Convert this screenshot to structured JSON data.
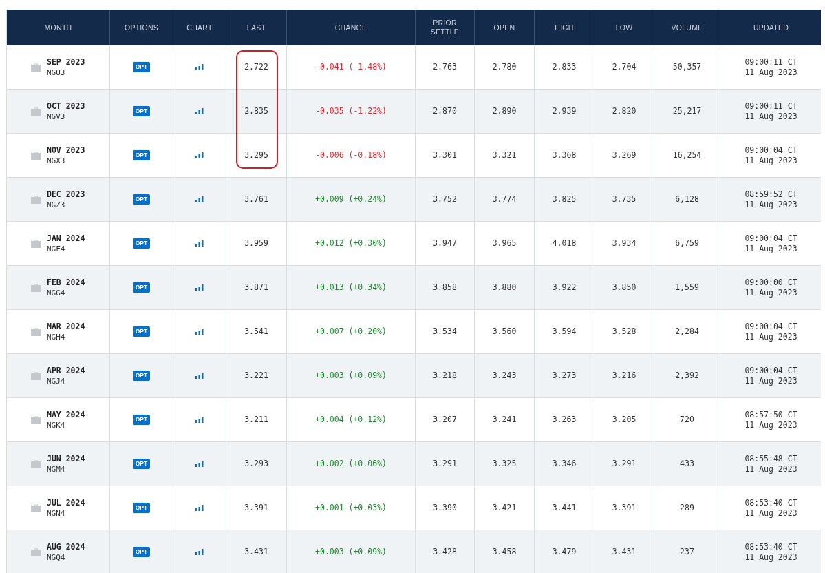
{
  "table": {
    "columns": [
      "MONTH",
      "OPTIONS",
      "CHART",
      "LAST",
      "CHANGE",
      "PRIOR SETTLE",
      "OPEN",
      "HIGH",
      "LOW",
      "VOLUME",
      "UPDATED"
    ],
    "rows": [
      {
        "month": "SEP 2023",
        "code": "NGU3",
        "options": "OPT",
        "last": "2.722",
        "change": "-0.041 (-1.48%)",
        "color": "#e8262b",
        "prior_settle": "2.763",
        "open": "2.780",
        "high": "2.833",
        "low": "2.704",
        "volume": "50,357",
        "updated_time": "09:00:11 CT",
        "updated_date": "11 Aug 2023",
        "highlighted": true
      },
      {
        "month": "OCT 2023",
        "code": "NGV3",
        "options": "OPT",
        "last": "2.835",
        "change": "-0.035 (-1.22%)",
        "color": "#e8262b",
        "prior_settle": "2.870",
        "open": "2.890",
        "high": "2.939",
        "low": "2.820",
        "volume": "25,217",
        "updated_time": "09:00:11 CT",
        "updated_date": "11 Aug 2023",
        "highlighted": true
      },
      {
        "month": "NOV 2023",
        "code": "NGX3",
        "options": "OPT",
        "last": "3.295",
        "change": "-0.006 (-0.18%)",
        "color": "#e8262b",
        "prior_settle": "3.301",
        "open": "3.321",
        "high": "3.368",
        "low": "3.269",
        "volume": "16,254",
        "updated_time": "09:00:04 CT",
        "updated_date": "11 Aug 2023",
        "highlighted": true
      },
      {
        "month": "DEC 2023",
        "code": "NGZ3",
        "options": "OPT",
        "last": "3.761",
        "change": "+0.009 (+0.24%)",
        "color": "#1f8a2e",
        "prior_settle": "3.752",
        "open": "3.774",
        "high": "3.825",
        "low": "3.735",
        "volume": "6,128",
        "updated_time": "08:59:52 CT",
        "updated_date": "11 Aug 2023",
        "highlighted": false
      },
      {
        "month": "JAN 2024",
        "code": "NGF4",
        "options": "OPT",
        "last": "3.959",
        "change": "+0.012 (+0.30%)",
        "color": "#1f8a2e",
        "prior_settle": "3.947",
        "open": "3.965",
        "high": "4.018",
        "low": "3.934",
        "volume": "6,759",
        "updated_time": "09:00:04 CT",
        "updated_date": "11 Aug 2023",
        "highlighted": false
      },
      {
        "month": "FEB 2024",
        "code": "NGG4",
        "options": "OPT",
        "last": "3.871",
        "change": "+0.013 (+0.34%)",
        "color": "#1f8a2e",
        "prior_settle": "3.858",
        "open": "3.880",
        "high": "3.922",
        "low": "3.850",
        "volume": "1,559",
        "updated_time": "09:00:00 CT",
        "updated_date": "11 Aug 2023",
        "highlighted": false
      },
      {
        "month": "MAR 2024",
        "code": "NGH4",
        "options": "OPT",
        "last": "3.541",
        "change": "+0.007 (+0.20%)",
        "color": "#1f8a2e",
        "prior_settle": "3.534",
        "open": "3.560",
        "high": "3.594",
        "low": "3.528",
        "volume": "2,284",
        "updated_time": "09:00:04 CT",
        "updated_date": "11 Aug 2023",
        "highlighted": false
      },
      {
        "month": "APR 2024",
        "code": "NGJ4",
        "options": "OPT",
        "last": "3.221",
        "change": "+0.003 (+0.09%)",
        "color": "#1f8a2e",
        "prior_settle": "3.218",
        "open": "3.243",
        "high": "3.273",
        "low": "3.216",
        "volume": "2,392",
        "updated_time": "09:00:04 CT",
        "updated_date": "11 Aug 2023",
        "highlighted": false
      },
      {
        "month": "MAY 2024",
        "code": "NGK4",
        "options": "OPT",
        "last": "3.211",
        "change": "+0.004 (+0.12%)",
        "color": "#1f8a2e",
        "prior_settle": "3.207",
        "open": "3.241",
        "high": "3.263",
        "low": "3.205",
        "volume": "720",
        "updated_time": "08:57:50 CT",
        "updated_date": "11 Aug 2023",
        "highlighted": false
      },
      {
        "month": "JUN 2024",
        "code": "NGM4",
        "options": "OPT",
        "last": "3.293",
        "change": "+0.002 (+0.06%)",
        "color": "#1f8a2e",
        "prior_settle": "3.291",
        "open": "3.325",
        "high": "3.346",
        "low": "3.291",
        "volume": "433",
        "updated_time": "08:55:48 CT",
        "updated_date": "11 Aug 2023",
        "highlighted": false
      },
      {
        "month": "JUL 2024",
        "code": "NGN4",
        "options": "OPT",
        "last": "3.391",
        "change": "+0.001 (+0.03%)",
        "color": "#1f8a2e",
        "prior_settle": "3.390",
        "open": "3.421",
        "high": "3.441",
        "low": "3.391",
        "volume": "289",
        "updated_time": "08:53:40 CT",
        "updated_date": "11 Aug 2023",
        "highlighted": false
      },
      {
        "month": "AUG 2024",
        "code": "NGQ4",
        "options": "OPT",
        "last": "3.431",
        "change": "+0.003 (+0.09%)",
        "color": "#1f8a2e",
        "prior_settle": "3.428",
        "open": "3.458",
        "high": "3.479",
        "low": "3.431",
        "volume": "237",
        "updated_time": "08:53:40 CT",
        "updated_date": "11 Aug 2023",
        "highlighted": false
      }
    ]
  }
}
